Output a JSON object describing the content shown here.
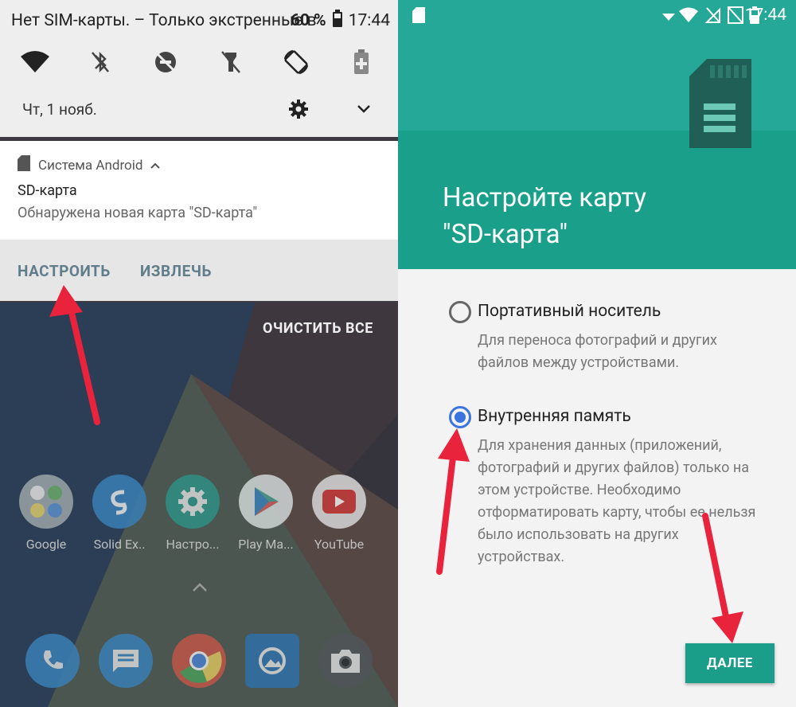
{
  "left": {
    "status": {
      "sim_text": "Нет SIM-карты. – Только экстренные в",
      "battery_percent": "60 %",
      "time": "17:44"
    },
    "quick_settings": {
      "date": "Чт, 1 нояб.",
      "icons": [
        "wifi-icon",
        "bluetooth-off-icon",
        "do-not-disturb-off-icon",
        "flashlight-off-icon",
        "auto-rotate-icon",
        "battery-saver-icon"
      ]
    },
    "notification": {
      "app_name": "Система Android",
      "title": "SD-карта",
      "body": "Обнаружена новая карта \"SD-карта\"",
      "action_setup": "НАСТРОИТЬ",
      "action_eject": "ИЗВЛЕЧЬ"
    },
    "clear_all": "ОЧИСТИТЬ ВСЕ",
    "apps": [
      {
        "label": "Google",
        "icon": "google-folder-icon"
      },
      {
        "label": "Solid Ex..",
        "icon": "solid-explorer-icon"
      },
      {
        "label": "Настро...",
        "icon": "settings-icon"
      },
      {
        "label": "Play Ma...",
        "icon": "play-market-icon"
      },
      {
        "label": "YouTube",
        "icon": "youtube-icon"
      }
    ],
    "dock": [
      "phone-icon",
      "messages-icon",
      "chrome-icon",
      "gallery-icon",
      "camera-icon"
    ]
  },
  "right": {
    "status": {
      "time": "17:44"
    },
    "title": "Настройте карту\n\"SD-карта\"",
    "options": [
      {
        "title": "Портативный носитель",
        "description": "Для переноса фотографий и других файлов между устройствами.",
        "selected": false
      },
      {
        "title": "Внутренняя память",
        "description": "Для хранения данных (приложений, фотографий и других файлов) только на этом устройстве. Необходимо отформатировать карту, чтобы ее нельзя было использовать на других устройствах.",
        "selected": true
      }
    ],
    "next_label": "ДАЛЕЕ"
  },
  "colors": {
    "accent_teal": "#1a9e8a",
    "hero_light": "#26a898",
    "radio_blue": "#3b73e0",
    "arrow_red": "#e8233b"
  }
}
